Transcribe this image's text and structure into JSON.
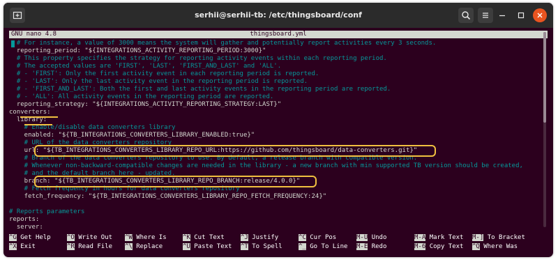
{
  "window": {
    "title": "serhii@serhii-tb: /etc/thingsboard/conf",
    "icons": {
      "new_tab": "new-tab-icon",
      "search": "search-icon",
      "menu": "hamburger-menu-icon",
      "minimize": "minimize-icon",
      "maximize": "maximize-icon",
      "close": "close-icon"
    },
    "accent_close": "#e95420"
  },
  "nano": {
    "version": "GNU nano 4.8",
    "filename": "thingsboard.yml"
  },
  "editor": {
    "lines": [
      {
        "text": "  # For instance, a value of 3000 means the system will gather and potentially report activities every 3 seconds.",
        "type": "comment"
      },
      {
        "text": "  reporting_period: \"${INTEGRATIONS_ACTIVITY_REPORTING_PERIOD:3000}\"",
        "type": "code"
      },
      {
        "text": "  # This property specifies the strategy for reporting activity events within each reporting period.",
        "type": "comment"
      },
      {
        "text": "  # The accepted values are 'FIRST', 'LAST', 'FIRST_AND_LAST' and 'ALL'.",
        "type": "comment"
      },
      {
        "text": "  # - 'FIRST': Only the first activity event in each reporting period is reported.",
        "type": "comment"
      },
      {
        "text": "  # - 'LAST': Only the last activity event in the reporting period is reported.",
        "type": "comment"
      },
      {
        "text": "  # - 'FIRST_AND_LAST': Both the first and last activity events in the reporting period are reported.",
        "type": "comment"
      },
      {
        "text": "  # - 'ALL': All activity events in the reporting period are reported.",
        "type": "comment"
      },
      {
        "text": "  reporting_strategy: \"${INTEGRATIONS_ACTIVITY_REPORTING_STRATEGY:LAST}\"",
        "type": "code"
      },
      {
        "text": "converters:",
        "type": "code"
      },
      {
        "text": "  library:",
        "type": "code"
      },
      {
        "text": "    # Enable/disable data converters library",
        "type": "comment"
      },
      {
        "text": "    enabled: \"${TB_INTEGRATIONS_CONVERTERS_LIBRARY_ENABLED:true}\"",
        "type": "code"
      },
      {
        "text": "    # URL of the data converters repository",
        "type": "comment"
      },
      {
        "text": "    url: \"${TB_INTEGRATIONS_CONVERTERS_LIBRARY_REPO_URL:https://github.com/thingsboard/data-converters.git}\"",
        "type": "code"
      },
      {
        "text": "    # Branch of the data converters repository to use. By default, a release branch with compatible version.",
        "type": "comment"
      },
      {
        "text": "    # Whenever non-backward-compatible changes are needed in the library - a new branch with min supported TB version should be created,",
        "type": "comment"
      },
      {
        "text": "    # and the default branch here - updated.",
        "type": "comment"
      },
      {
        "text": "    branch: \"${TB_INTEGRATIONS_CONVERTERS_LIBRARY_REPO_BRANCH:release/4.0.0}\"",
        "type": "code"
      },
      {
        "text": "    # Fetch frequency in hours for data converters repository",
        "type": "comment"
      },
      {
        "text": "    fetch_frequency: \"${TB_INTEGRATIONS_CONVERTERS_LIBRARY_REPO_FETCH_FREQUENCY:24}\"",
        "type": "code"
      },
      {
        "text": "",
        "type": "code"
      },
      {
        "text": "# Reports parameters",
        "type": "comment"
      },
      {
        "text": "reports:",
        "type": "code"
      },
      {
        "text": "  server:",
        "type": "code"
      }
    ]
  },
  "shortcuts": [
    {
      "key": "^G",
      "label": "Get Help"
    },
    {
      "key": "^X",
      "label": "Exit"
    },
    {
      "key": "^O",
      "label": "Write Out"
    },
    {
      "key": "^R",
      "label": "Read File"
    },
    {
      "key": "^W",
      "label": "Where Is"
    },
    {
      "key": "^\\",
      "label": "Replace"
    },
    {
      "key": "^K",
      "label": "Cut Text"
    },
    {
      "key": "^U",
      "label": "Paste Text"
    },
    {
      "key": "^J",
      "label": "Justify"
    },
    {
      "key": "^T",
      "label": "To Spell"
    },
    {
      "key": "^C",
      "label": "Cur Pos"
    },
    {
      "key": "^_",
      "label": "Go To Line"
    },
    {
      "key": "M-U",
      "label": "Undo"
    },
    {
      "key": "M-E",
      "label": "Redo"
    },
    {
      "key": "M-A",
      "label": "Mark Text"
    },
    {
      "key": "M-6",
      "label": "Copy Text"
    },
    {
      "key": "M-]",
      "label": "To Bracket"
    },
    {
      "key": "^Q",
      "label": "Where Was"
    }
  ]
}
